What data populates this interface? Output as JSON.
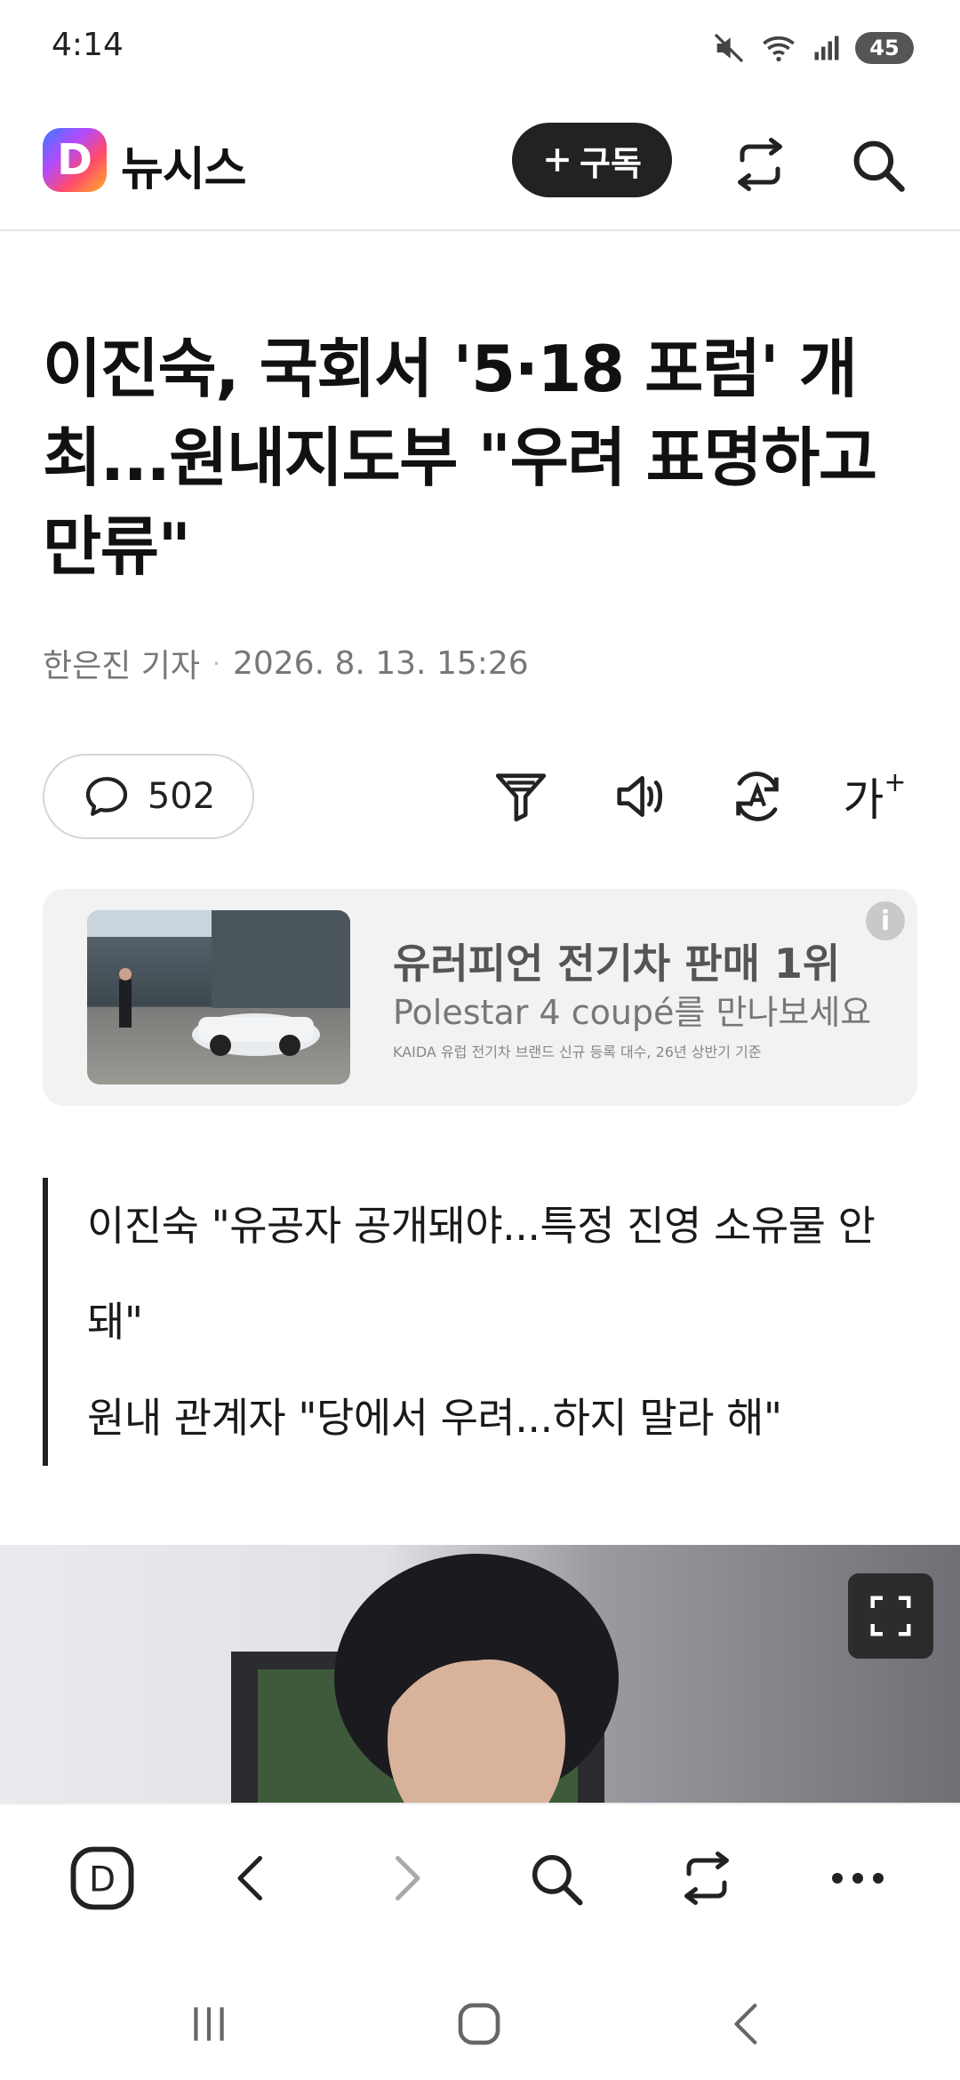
{
  "status_bar": {
    "time": "4:14",
    "battery": "45"
  },
  "header": {
    "logo_letter": "D",
    "brand": "뉴시스",
    "subscribe_label": "구독"
  },
  "article": {
    "headline": "이진숙, 국회서 '5·18 포럼' 개최...원내지도부 \"우려 표명하고 만류\"",
    "reporter": "한은진 기자",
    "datetime": "2026. 8. 13. 15:26",
    "comment_count": "502",
    "font_size_label": "가",
    "summary": [
      "이진숙 \"유공자 공개돼야...특정 진영 소유물 안 돼\"",
      "원내 관계자 \"당에서 우려...하지 말라 해\""
    ]
  },
  "ad": {
    "title": "유러피언 전기차 판매 1위",
    "subtitle": "Polestar 4 coupé를 만나보세요",
    "fineprint": "KAIDA 유럽 전기차 브랜드 신규 등록 대수, 26년 상반기 기준",
    "info": "i"
  },
  "browser_bar": {
    "home_letter": "D"
  },
  "icons": {
    "header": [
      "subscribe-plus-icon",
      "share-icon",
      "search-icon"
    ],
    "tools": [
      "comment-icon",
      "summary-filter-icon",
      "speaker-icon",
      "translate-icon",
      "font-size-icon"
    ],
    "browser": [
      "home-icon",
      "back-icon",
      "forward-icon",
      "search-icon",
      "share-icon",
      "more-icon"
    ],
    "nav": [
      "recents-icon",
      "home-icon",
      "back-icon"
    ]
  },
  "colors": {
    "text": "#111111",
    "muted": "#777777",
    "button_dark": "#222222",
    "ad_bg": "#f2f2f3"
  }
}
